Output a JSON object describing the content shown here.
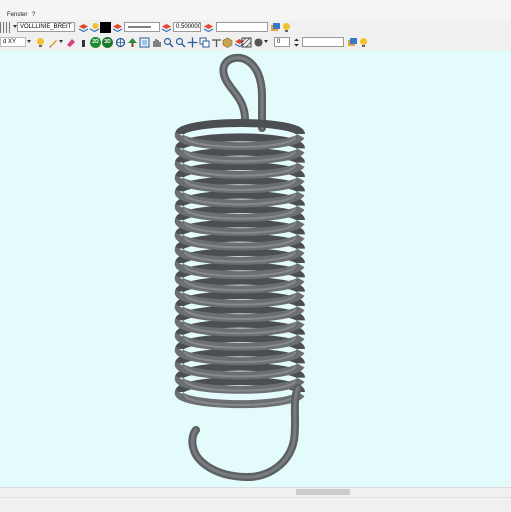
{
  "menubar": {
    "items": [
      "Fenster",
      "?"
    ]
  },
  "toolbar1": {
    "linetype_value": "VOLLLINIE_BREIT",
    "lineweight_value": "0.500000",
    "text_field_value": ""
  },
  "toolbar2": {
    "view_value": "d XY",
    "btn_2d": "2D",
    "btn_3d": "3D",
    "number_value": "0",
    "text_field_value": ""
  },
  "colors": {
    "viewport_bg": "#e4fbfc",
    "spring": "#6f7274",
    "toolbar_bg": "#f0f0f0"
  },
  "viewport": {
    "model": "extension-spring-icon"
  }
}
